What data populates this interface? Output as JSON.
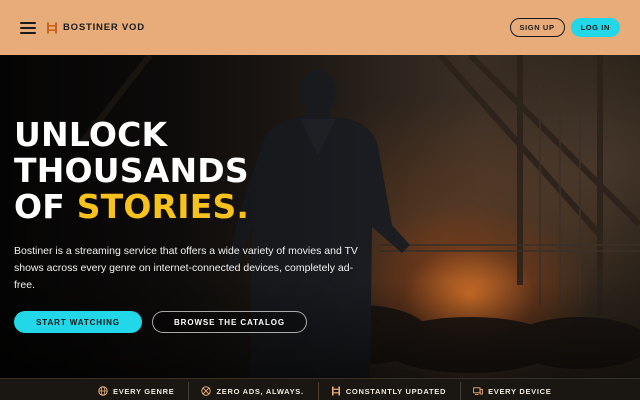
{
  "header": {
    "brand": "BOSTINER VOD",
    "signup_label": "SIGN UP",
    "login_label": "LOG IN",
    "icons": {
      "menu": "hamburger-menu-icon",
      "logo": "ladder-logo-icon"
    }
  },
  "hero": {
    "headline_line1": "UNLOCK",
    "headline_line2": "THOUSANDS",
    "headline_line3_prefix": "OF",
    "headline_line3_accent": "STORIES.",
    "description": "Bostiner is a streaming service that offers a wide variety of movies and TV shows across every genre on internet-connected devices, completely ad-free.",
    "primary_cta": "START WATCHING",
    "secondary_cta": "BROWSE THE CATALOG"
  },
  "features": [
    {
      "label": "EVERY GENRE",
      "icon": "globe-icon"
    },
    {
      "label": "ZERO ADS, ALWAYS.",
      "icon": "no-ads-icon"
    },
    {
      "label": "CONSTANTLY UPDATED",
      "icon": "ladder-icon"
    },
    {
      "label": "EVERY DEVICE",
      "icon": "devices-icon"
    }
  ],
  "colors": {
    "header_bg": "#e8ac7a",
    "accent_cyan": "#22d8e8",
    "accent_yellow": "#f6c21b",
    "text_dark": "#1a1a1a"
  }
}
